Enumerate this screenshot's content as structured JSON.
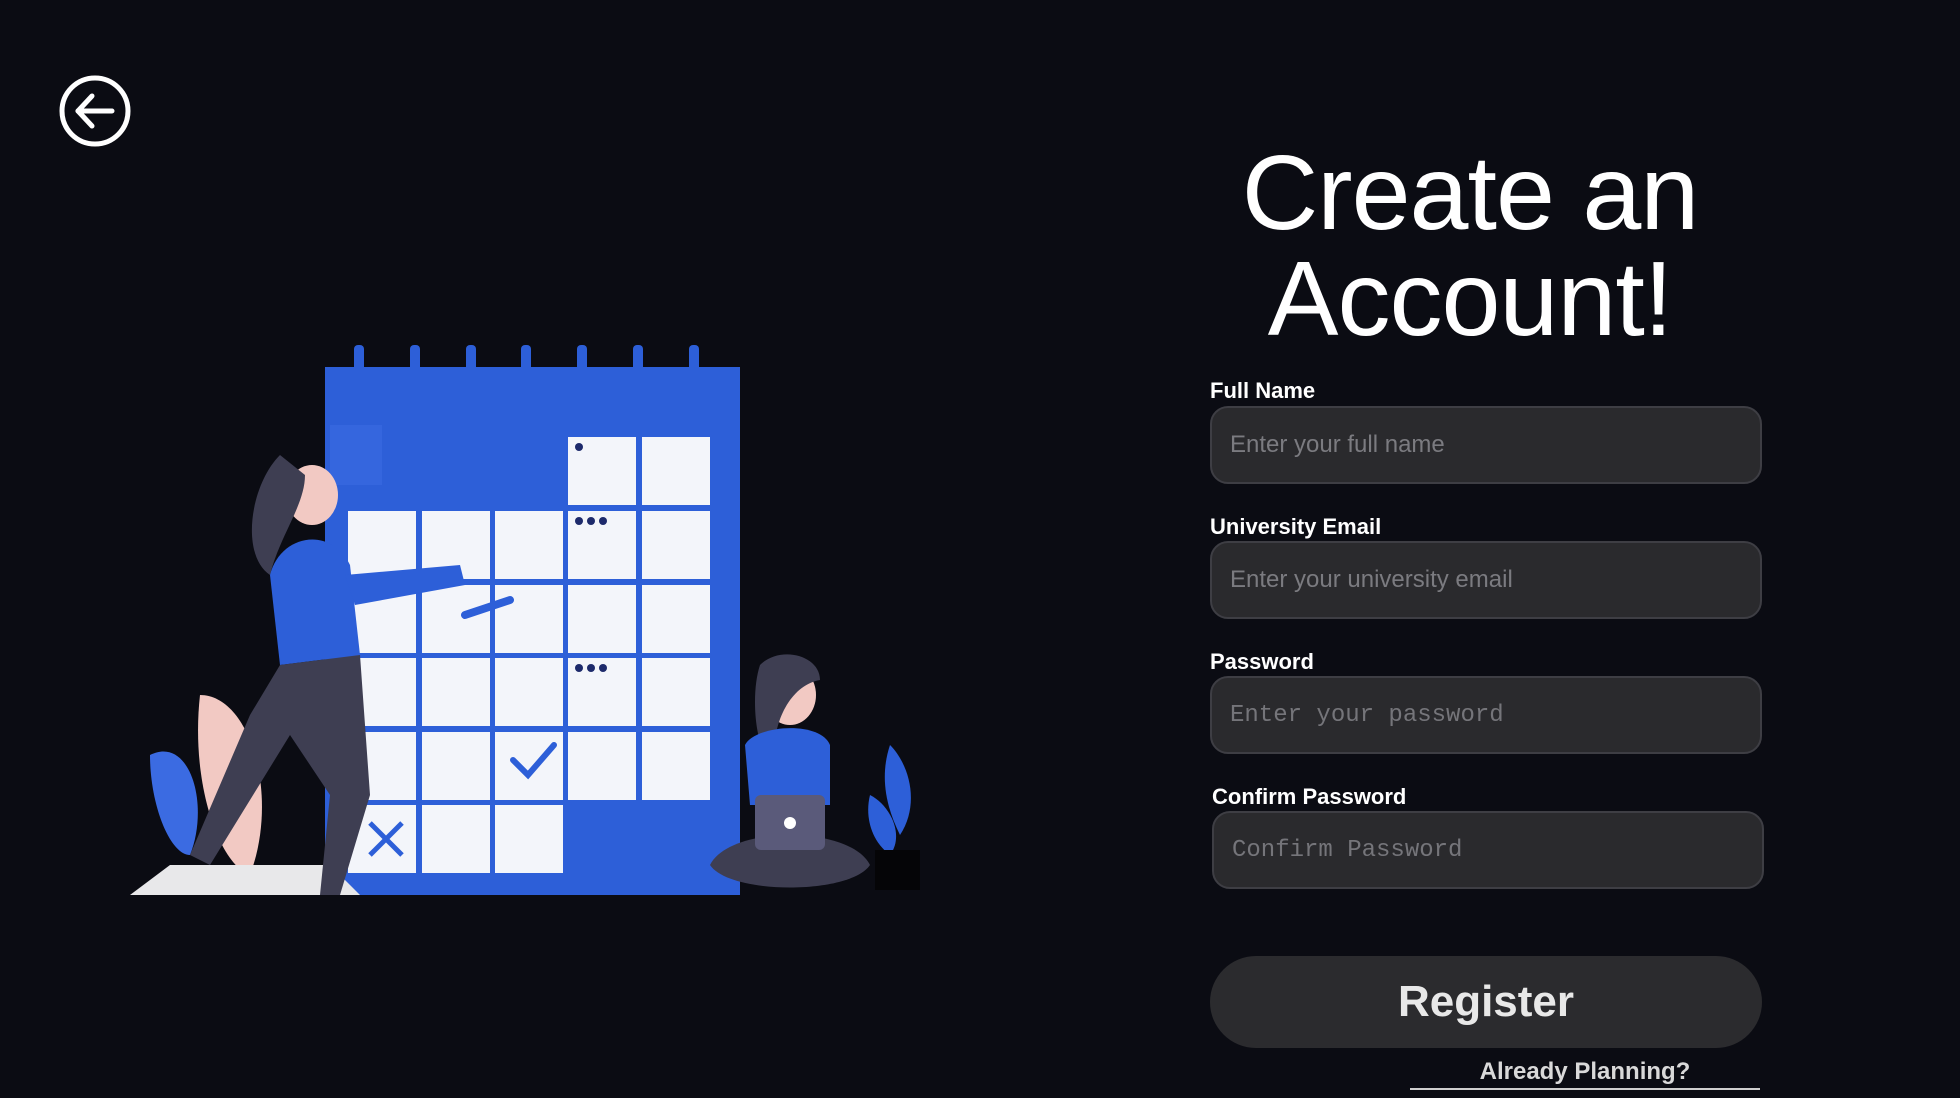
{
  "header": {
    "back_icon": "arrow-left-circle-icon"
  },
  "form": {
    "title_line1": "Create an",
    "title_line2": "Account!",
    "fields": [
      {
        "label": "Full Name",
        "placeholder": "Enter your full name",
        "value": ""
      },
      {
        "label": "University Email",
        "placeholder": "Enter your university email",
        "value": ""
      },
      {
        "label": "Password",
        "placeholder": "Enter your password",
        "value": ""
      },
      {
        "label": "Confirm Password",
        "placeholder": "Confirm Password",
        "value": ""
      }
    ],
    "register_label": "Register",
    "already_link": "Already Planning?"
  },
  "colors": {
    "background": "#0b0c13",
    "accent_blue": "#2d5fd8",
    "input_bg": "#2a2a2d",
    "button_bg": "#2b2b2e"
  }
}
